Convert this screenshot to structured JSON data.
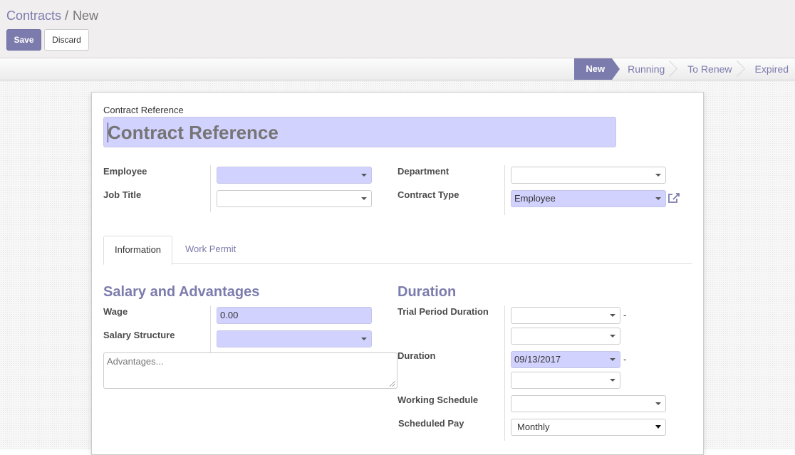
{
  "breadcrumb": {
    "parent": "Contracts",
    "separator": "/",
    "current": "New"
  },
  "toolbar": {
    "save_label": "Save",
    "discard_label": "Discard"
  },
  "statusbar": {
    "stages": [
      "New",
      "Running",
      "To Renew",
      "Expired"
    ],
    "active": "New"
  },
  "form": {
    "reference_label": "Contract Reference",
    "reference_placeholder": "Contract Reference",
    "employee_label": "Employee",
    "employee_value": "",
    "job_title_label": "Job Title",
    "job_title_value": "",
    "department_label": "Department",
    "department_value": "",
    "contract_type_label": "Contract Type",
    "contract_type_value": "Employee"
  },
  "tabs": [
    {
      "label": "Information",
      "active": true
    },
    {
      "label": "Work Permit",
      "active": false
    }
  ],
  "salary": {
    "title": "Salary and Advantages",
    "wage_label": "Wage",
    "wage_value": "0.00",
    "structure_label": "Salary Structure",
    "structure_value": "",
    "advantages_placeholder": "Advantages..."
  },
  "duration": {
    "title": "Duration",
    "trial_label": "Trial Period Duration",
    "trial_start": "",
    "trial_end": "",
    "duration_label": "Duration",
    "duration_start": "09/13/2017",
    "duration_end": "",
    "dash": "-",
    "working_schedule_label": "Working Schedule",
    "working_schedule_value": "",
    "scheduled_pay_label": "Scheduled Pay",
    "scheduled_pay_value": "Monthly"
  },
  "colors": {
    "primary": "#7c7bad",
    "required_bg": "#d2d2ff"
  }
}
